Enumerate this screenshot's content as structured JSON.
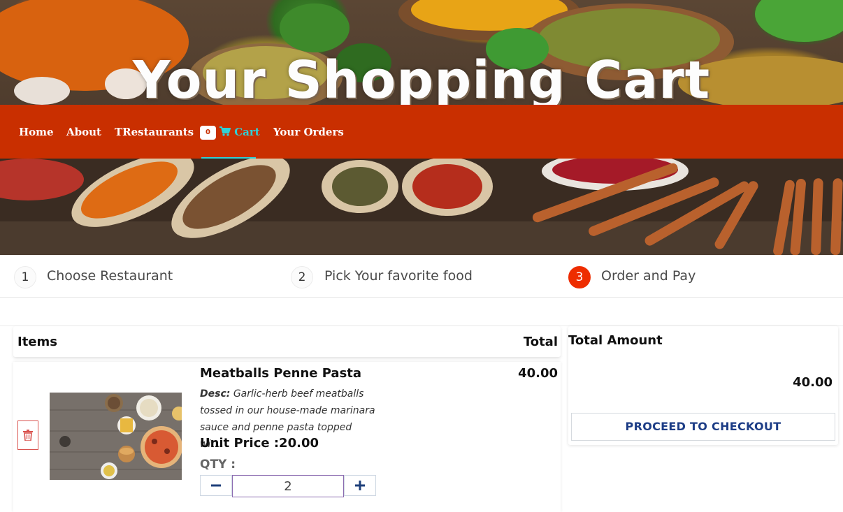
{
  "hero": {
    "title": "Your Shopping Cart"
  },
  "nav": {
    "items": [
      {
        "label": "Home"
      },
      {
        "label": "About"
      },
      {
        "label": "TRestaurants"
      },
      {
        "label": "Cart"
      },
      {
        "label": "Your Orders"
      }
    ],
    "cart_count": "0",
    "colors": {
      "bar": "#c92f00",
      "active": "#2fd1d6"
    }
  },
  "steps": [
    {
      "number": "1",
      "label": "Choose Restaurant"
    },
    {
      "number": "2",
      "label": "Pick Your favorite food"
    },
    {
      "number": "3",
      "label": "Order and Pay",
      "active": true
    }
  ],
  "cart": {
    "header": {
      "items": "Items",
      "total": "Total"
    },
    "items": [
      {
        "name": "Meatballs Penne Pasta",
        "desc_label": "Desc:",
        "desc": "Garlic-herb beef meatballs tossed in our house-made marinara sauce and penne pasta topped wit...",
        "unit_price": "Unit Price :20.00",
        "qty_label": "QTY :",
        "qty": "2",
        "total": "40.00",
        "icons": {
          "delete": "trash-icon",
          "minus": "minus-icon",
          "plus": "plus-icon"
        }
      }
    ]
  },
  "summary": {
    "title": "Total Amount",
    "amount": "40.00",
    "checkout_label": "PROCEED TO CHECKOUT"
  }
}
